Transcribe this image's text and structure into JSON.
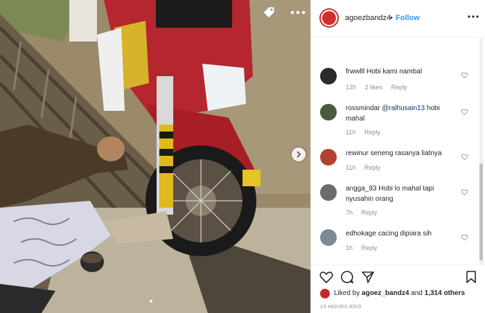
{
  "header": {
    "username": "agoezbandz4",
    "separator": "•",
    "follow_label": "Follow"
  },
  "comments": [
    {
      "user": "frwwlll",
      "mention": "",
      "text": "Hobi kami nambal",
      "time": "12h",
      "likes": "2 likes",
      "reply": "Reply",
      "avatar_color": "#2b2b2b"
    },
    {
      "user": "rossmindar",
      "mention": "@ralhusain13",
      "text": "hobi mahal",
      "time": "11h",
      "likes": "",
      "reply": "Reply",
      "avatar_color": "#4a5a3a"
    },
    {
      "user": "rewinur",
      "mention": "",
      "text": "seneng rasanya liatnya",
      "time": "11h",
      "likes": "",
      "reply": "Reply",
      "avatar_color": "#b3412f"
    },
    {
      "user": "angga_93",
      "mention": "",
      "text": "Hobi lo mahal tapi nyusahin orang",
      "time": "7h",
      "likes": "",
      "reply": "Reply",
      "avatar_color": "#6b6b6b"
    },
    {
      "user": "edhokage",
      "mention": "",
      "text": "cacing dipiara sih",
      "time": "1h",
      "likes": "",
      "reply": "Reply",
      "avatar_color": "#7a8a96"
    }
  ],
  "likes": {
    "prefix": "Liked by",
    "user": "agoez_bandz4",
    "middle": "and",
    "others": "1,314 others"
  },
  "timestamp": "23 HOURS AGO",
  "icons": [
    "tag-icon",
    "more-icon",
    "next-arrow-icon",
    "heart-icon",
    "comment-icon",
    "share-icon",
    "bookmark-icon"
  ],
  "colors": {
    "follow": "#3897f0",
    "avatar_ring": "#c62828",
    "meta": "#8e8e8e"
  }
}
